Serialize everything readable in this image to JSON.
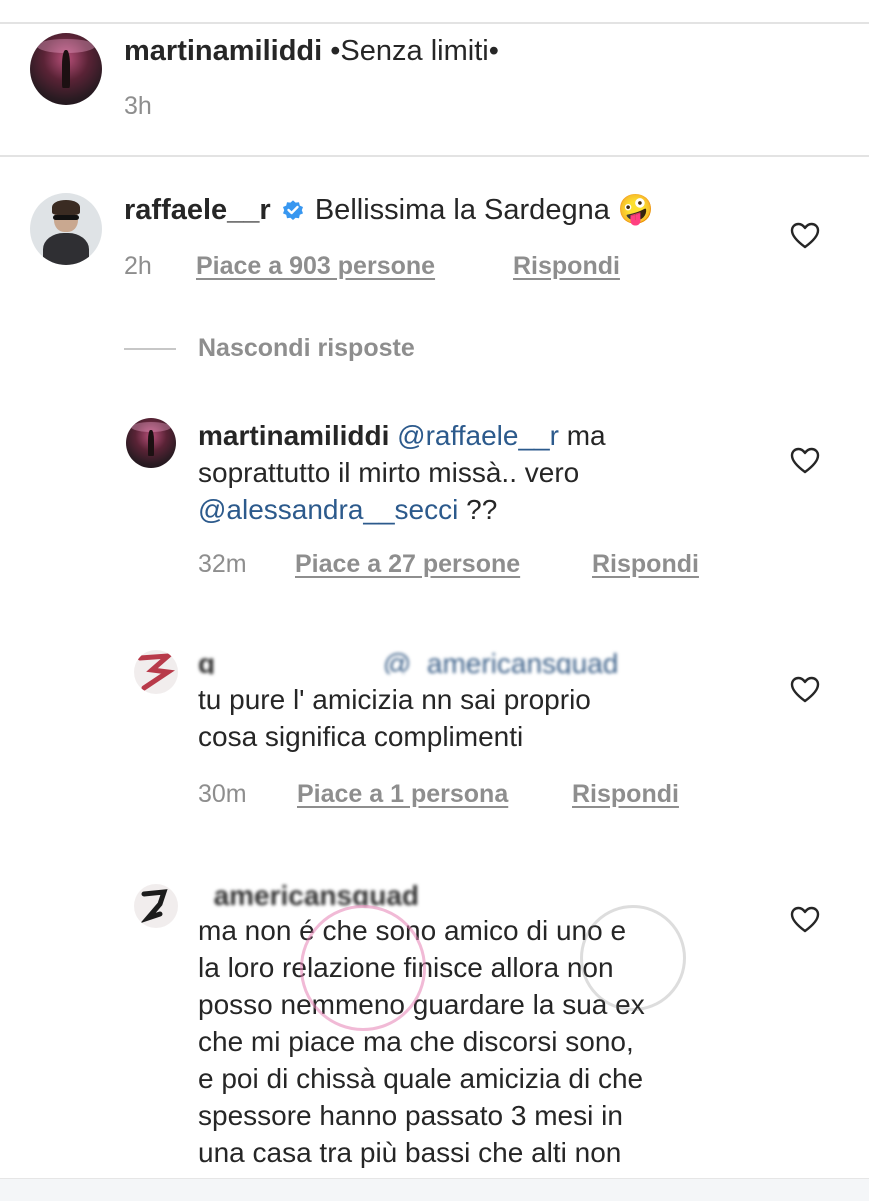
{
  "post": {
    "username": "martinamiliddi",
    "caption": "•Senza limiti•",
    "time": "3h"
  },
  "comment": {
    "username": "raffaele__r",
    "text": "Bellissima la Sardegna 🤪",
    "time": "2h",
    "likes_label": "Piace a 903 persone",
    "reply_label": "Rispondi"
  },
  "replies_toggle": "Nascondi risposte",
  "replies": [
    {
      "username": "martinamiliddi",
      "line1_mention": "@raffaele__r",
      "line1_rest": " ma",
      "line2": "soprattutto il mirto missà.. vero",
      "line3_mention": "@alessandra__secci",
      "line3_rest": " ??",
      "time": "32m",
      "likes_label": "Piace a 27 persone",
      "reply_label": "Rispondi"
    },
    {
      "username_blurred": "g",
      "mention": "@_americansquad__",
      "lines": [
        "tu pure l' amicizia nn sai proprio",
        "cosa significa complimenti"
      ],
      "time": "30m",
      "likes_label": "Piace a 1 persona",
      "reply_label": "Rispondi"
    },
    {
      "username_blurred": "_americansquad",
      "lines": [
        "ma non é che sono amico di uno e",
        "la loro relazione finisce allora non",
        "posso nemmeno guardare la sua ex",
        "che mi piace ma che discorsi sono,",
        "e poi di chissà quale amicizia di che",
        "spessore hanno passato 3 mesi in",
        "una casa tra più bassi che alti non"
      ]
    }
  ],
  "colors": {
    "text": "#262626",
    "meta": "#8e8e8e",
    "mention": "#2c5a8c",
    "verified": "#3897f0"
  },
  "icons": [
    "heart-icon",
    "verified-badge-icon"
  ]
}
